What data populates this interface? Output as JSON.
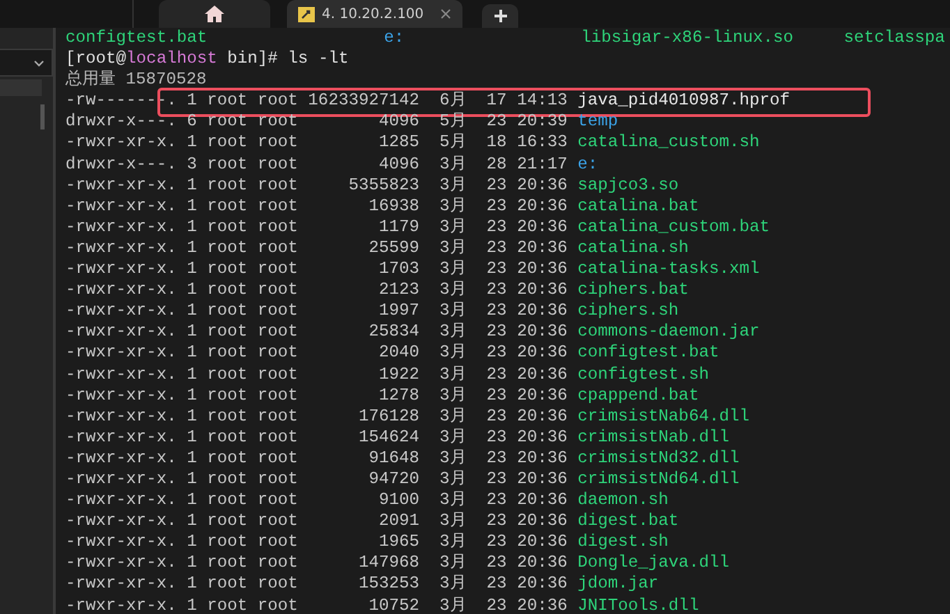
{
  "tabs": [
    {
      "kind": "home",
      "selected": false
    },
    {
      "kind": "session",
      "label": "4. 10.20.2.100",
      "selected": true
    }
  ],
  "terminal": {
    "ls_columns": [
      {
        "name": "configtest.bat",
        "kind": "exec"
      },
      {
        "name": "e:",
        "kind": "dir"
      },
      {
        "name": "libsigar-x86-linux.so",
        "kind": "exec"
      },
      {
        "name": "setclasspa",
        "kind": "exec"
      }
    ],
    "prompt": {
      "user": "[root@",
      "host": "localhost",
      "path": " bin]#",
      "command": "ls -lt"
    },
    "total": "总用量 15870528",
    "rows": [
      {
        "meta": "-rw-------. 1 root root 16233927142  6月  17 14:13",
        "name": "java_pid4010987.hprof",
        "kind": "file",
        "highlighted": true
      },
      {
        "meta": "drwxr-x---. 6 root root        4096  5月  23 20:39",
        "name": "temp",
        "kind": "dir",
        "highlighted": false
      },
      {
        "meta": "-rwxr-xr-x. 1 root root        1285  5月  18 16:33",
        "name": "catalina_custom.sh",
        "kind": "exec",
        "highlighted": false
      },
      {
        "meta": "drwxr-x---. 3 root root        4096  3月  28 21:17",
        "name": "e:",
        "kind": "dir",
        "highlighted": false
      },
      {
        "meta": "-rwxr-xr-x. 1 root root     5355823  3月  23 20:36",
        "name": "sapjco3.so",
        "kind": "exec",
        "highlighted": false
      },
      {
        "meta": "-rwxr-xr-x. 1 root root       16938  3月  23 20:36",
        "name": "catalina.bat",
        "kind": "exec",
        "highlighted": false
      },
      {
        "meta": "-rwxr-xr-x. 1 root root        1179  3月  23 20:36",
        "name": "catalina_custom.bat",
        "kind": "exec",
        "highlighted": false
      },
      {
        "meta": "-rwxr-xr-x. 1 root root       25599  3月  23 20:36",
        "name": "catalina.sh",
        "kind": "exec",
        "highlighted": false
      },
      {
        "meta": "-rwxr-xr-x. 1 root root        1703  3月  23 20:36",
        "name": "catalina-tasks.xml",
        "kind": "exec",
        "highlighted": false
      },
      {
        "meta": "-rwxr-xr-x. 1 root root        2123  3月  23 20:36",
        "name": "ciphers.bat",
        "kind": "exec",
        "highlighted": false
      },
      {
        "meta": "-rwxr-xr-x. 1 root root        1997  3月  23 20:36",
        "name": "ciphers.sh",
        "kind": "exec",
        "highlighted": false
      },
      {
        "meta": "-rwxr-xr-x. 1 root root       25834  3月  23 20:36",
        "name": "commons-daemon.jar",
        "kind": "exec",
        "highlighted": false
      },
      {
        "meta": "-rwxr-xr-x. 1 root root        2040  3月  23 20:36",
        "name": "configtest.bat",
        "kind": "exec",
        "highlighted": false
      },
      {
        "meta": "-rwxr-xr-x. 1 root root        1922  3月  23 20:36",
        "name": "configtest.sh",
        "kind": "exec",
        "highlighted": false
      },
      {
        "meta": "-rwxr-xr-x. 1 root root        1278  3月  23 20:36",
        "name": "cpappend.bat",
        "kind": "exec",
        "highlighted": false
      },
      {
        "meta": "-rwxr-xr-x. 1 root root      176128  3月  23 20:36",
        "name": "crimsistNab64.dll",
        "kind": "exec",
        "highlighted": false
      },
      {
        "meta": "-rwxr-xr-x. 1 root root      154624  3月  23 20:36",
        "name": "crimsistNab.dll",
        "kind": "exec",
        "highlighted": false
      },
      {
        "meta": "-rwxr-xr-x. 1 root root       91648  3月  23 20:36",
        "name": "crimsistNd32.dll",
        "kind": "exec",
        "highlighted": false
      },
      {
        "meta": "-rwxr-xr-x. 1 root root       94720  3月  23 20:36",
        "name": "crimsistNd64.dll",
        "kind": "exec",
        "highlighted": false
      },
      {
        "meta": "-rwxr-xr-x. 1 root root        9100  3月  23 20:36",
        "name": "daemon.sh",
        "kind": "exec",
        "highlighted": false
      },
      {
        "meta": "-rwxr-xr-x. 1 root root        2091  3月  23 20:36",
        "name": "digest.bat",
        "kind": "exec",
        "highlighted": false
      },
      {
        "meta": "-rwxr-xr-x. 1 root root        1965  3月  23 20:36",
        "name": "digest.sh",
        "kind": "exec",
        "highlighted": false
      },
      {
        "meta": "-rwxr-xr-x. 1 root root      147968  3月  23 20:36",
        "name": "Dongle_java.dll",
        "kind": "exec",
        "highlighted": false
      },
      {
        "meta": "-rwxr-xr-x. 1 root root      153253  3月  23 20:36",
        "name": "jdom.jar",
        "kind": "exec",
        "highlighted": false
      },
      {
        "meta": "-rwxr-xr-x. 1 root root       10752  3月  23 20:36",
        "name": "JNITools.dll",
        "kind": "exec",
        "highlighted": false
      }
    ]
  }
}
